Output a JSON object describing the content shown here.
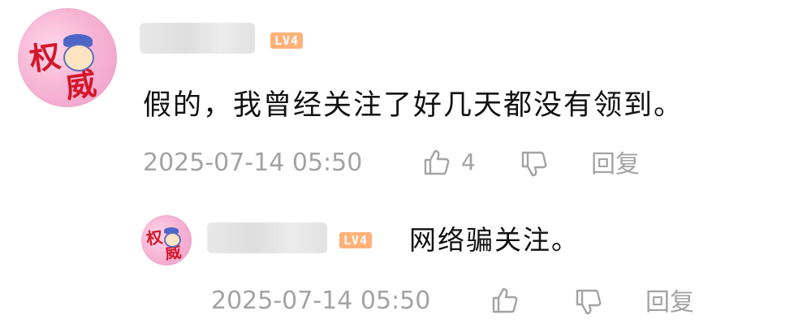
{
  "comment": {
    "avatar_icon": "avatar-icon",
    "username": "",
    "level_badge": "LV4",
    "text": "假的，我曾经关注了好几天都没有领到。",
    "timestamp": "2025-07-14 05:50",
    "like_count": "4",
    "reply_label": "回复",
    "like_icon": "thumbs-up-icon",
    "dislike_icon": "thumbs-down-icon"
  },
  "reply": {
    "avatar_icon": "avatar-icon",
    "username": "",
    "level_badge": "LV4",
    "text": "网络骗关注。",
    "timestamp": "2025-07-14 05:50",
    "reply_label": "回复",
    "like_icon": "thumbs-up-icon",
    "dislike_icon": "thumbs-down-icon"
  },
  "colors": {
    "meta_text": "#a3a3a3",
    "body_text": "#111111",
    "level_badge_bg": "#ffb27a",
    "avatar_text": "#d3172a"
  }
}
